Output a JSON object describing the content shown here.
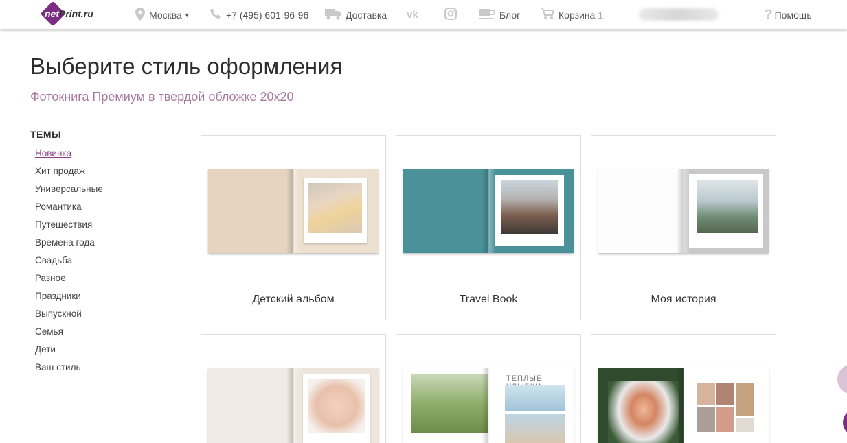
{
  "header": {
    "logo_prefix": "net",
    "logo_suffix": "Print.ru",
    "city": "Москва",
    "phone": "+7 (495) 601-96-96",
    "delivery": "Доставка",
    "blog": "Блог",
    "cart": "Корзина",
    "cart_count": "1",
    "help": "Помощь"
  },
  "page": {
    "title": "Выберите стиль оформления",
    "subtitle": "Фотокнига Премиум в твердой обложке 20х20"
  },
  "sidebar": {
    "heading": "ТЕМЫ",
    "items": [
      "Новинка",
      "Хит продаж",
      "Универсальные",
      "Романтика",
      "Путешествия",
      "Времена года",
      "Свадьба",
      "Разное",
      "Праздники",
      "Выпускной",
      "Семья",
      "Дети",
      "Ваш стиль"
    ]
  },
  "cards": [
    {
      "label": "Детский альбом"
    },
    {
      "label": "Travel Book"
    },
    {
      "label": "Моя история"
    },
    {
      "label": ""
    },
    {
      "label": "",
      "headline": "ТЕПЛЫЕ УЛЫБКИ"
    },
    {
      "label": ""
    }
  ],
  "colors": {
    "brand": "#7b2d83",
    "accent_text": "#a8799f",
    "active_link": "#8b3d86"
  }
}
